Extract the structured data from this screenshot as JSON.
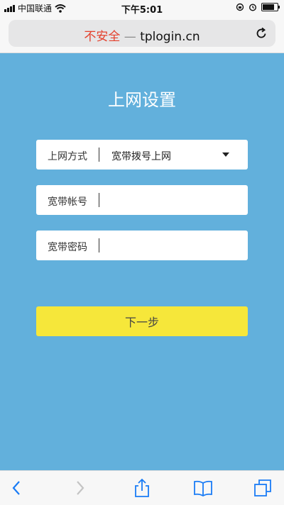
{
  "status_bar": {
    "carrier": "中国联通",
    "time": "下午5:01",
    "battery_level": 0.85
  },
  "browser": {
    "url_warning": "不安全",
    "url_separator": "—",
    "url_host": "tplogin.cn"
  },
  "page": {
    "title": "上网设置",
    "fields": {
      "connection_type": {
        "label": "上网方式",
        "value": "宽带拨号上网"
      },
      "account": {
        "label": "宽带帐号",
        "value": ""
      },
      "password": {
        "label": "宽带密码",
        "value": ""
      }
    },
    "next_button_label": "下一步"
  },
  "colors": {
    "background": "#62b0dc",
    "button": "#f6e73a",
    "warning": "#e4412d",
    "accent": "#1a7cf5"
  },
  "toolbar": {
    "icons": [
      "back-icon",
      "forward-icon",
      "share-icon",
      "bookmarks-icon",
      "tabs-icon"
    ]
  }
}
